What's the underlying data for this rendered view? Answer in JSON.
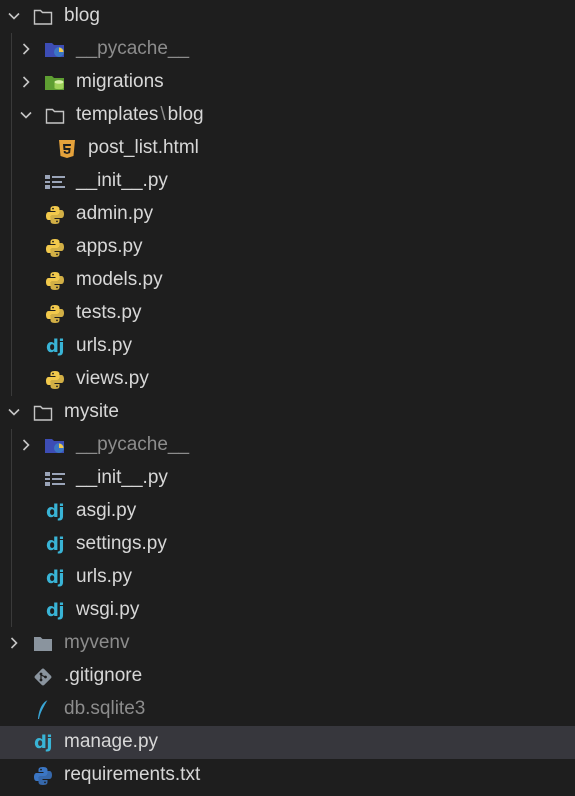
{
  "explorer": {
    "items": [
      {
        "label": "blog",
        "type": "folder",
        "expanded": true,
        "icon": "folder-open-icon"
      },
      {
        "label": "__pycache__",
        "type": "folder",
        "expanded": false,
        "icon": "python-folder-icon",
        "dimmed": true
      },
      {
        "label": "migrations",
        "type": "folder",
        "expanded": false,
        "icon": "database-folder-icon"
      },
      {
        "label": "templates",
        "label_suffix": "blog",
        "separator": "\\",
        "type": "folder",
        "expanded": true,
        "icon": "folder-open-icon"
      },
      {
        "label": "post_list.html",
        "type": "file",
        "icon": "html5-icon"
      },
      {
        "label": "__init__.py",
        "type": "file",
        "icon": "python-init-icon"
      },
      {
        "label": "admin.py",
        "type": "file",
        "icon": "python-icon"
      },
      {
        "label": "apps.py",
        "type": "file",
        "icon": "python-icon"
      },
      {
        "label": "models.py",
        "type": "file",
        "icon": "python-icon"
      },
      {
        "label": "tests.py",
        "type": "file",
        "icon": "python-icon"
      },
      {
        "label": "urls.py",
        "type": "file",
        "icon": "django-icon"
      },
      {
        "label": "views.py",
        "type": "file",
        "icon": "python-icon"
      },
      {
        "label": "mysite",
        "type": "folder",
        "expanded": true,
        "icon": "folder-open-icon"
      },
      {
        "label": "__pycache__",
        "type": "folder",
        "expanded": false,
        "icon": "python-folder-icon",
        "dimmed": true
      },
      {
        "label": "__init__.py",
        "type": "file",
        "icon": "python-init-icon"
      },
      {
        "label": "asgi.py",
        "type": "file",
        "icon": "django-icon"
      },
      {
        "label": "settings.py",
        "type": "file",
        "icon": "django-icon"
      },
      {
        "label": "urls.py",
        "type": "file",
        "icon": "django-icon"
      },
      {
        "label": "wsgi.py",
        "type": "file",
        "icon": "django-icon"
      },
      {
        "label": "myvenv",
        "type": "folder",
        "expanded": false,
        "icon": "folder-icon",
        "dimmed": true
      },
      {
        "label": ".gitignore",
        "type": "file",
        "icon": "git-icon"
      },
      {
        "label": "db.sqlite3",
        "type": "file",
        "icon": "sqlite-feather-icon",
        "dimmed": true
      },
      {
        "label": "manage.py",
        "type": "file",
        "icon": "django-icon",
        "selected": true
      },
      {
        "label": "requirements.txt",
        "type": "file",
        "icon": "python-requirements-icon"
      }
    ],
    "django_glyph": "dj"
  },
  "colors": {
    "background": "#1e1e1e",
    "selection": "#37373d",
    "text": "#d7d7d7",
    "dimmed_text": "#8c8c8c",
    "django": "#39b4d6",
    "python_blue": "#3b76c4",
    "python_yellow": "#f2c94c",
    "html5": "#e5a23b"
  }
}
